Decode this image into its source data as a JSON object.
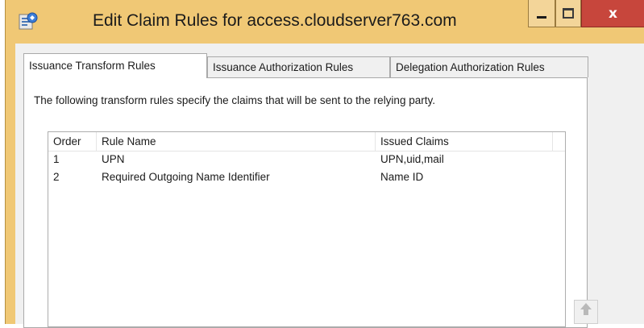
{
  "window": {
    "title": "Edit Claim Rules for access.cloudserver763.com",
    "controls": {
      "minimize": "minimize",
      "maximize": "maximize",
      "close": "x"
    },
    "accent_color": "#f0c875",
    "close_color": "#c7463c"
  },
  "tabs": [
    {
      "label": "Issuance Transform Rules",
      "selected": true
    },
    {
      "label": "Issuance Authorization Rules",
      "selected": false
    },
    {
      "label": "Delegation Authorization Rules",
      "selected": false
    }
  ],
  "panel": {
    "description": "The following transform rules specify the claims that will be sent to the relying party."
  },
  "rules_table": {
    "columns": [
      "Order",
      "Rule Name",
      "Issued Claims"
    ],
    "rows": [
      {
        "order": "1",
        "rule_name": "UPN",
        "issued_claims": "UPN,uid,mail"
      },
      {
        "order": "2",
        "rule_name": "Required Outgoing Name Identifier",
        "issued_claims": "Name ID"
      }
    ]
  },
  "icons": {
    "app": "claims-app-icon",
    "move_up": "arrow-up-icon"
  }
}
